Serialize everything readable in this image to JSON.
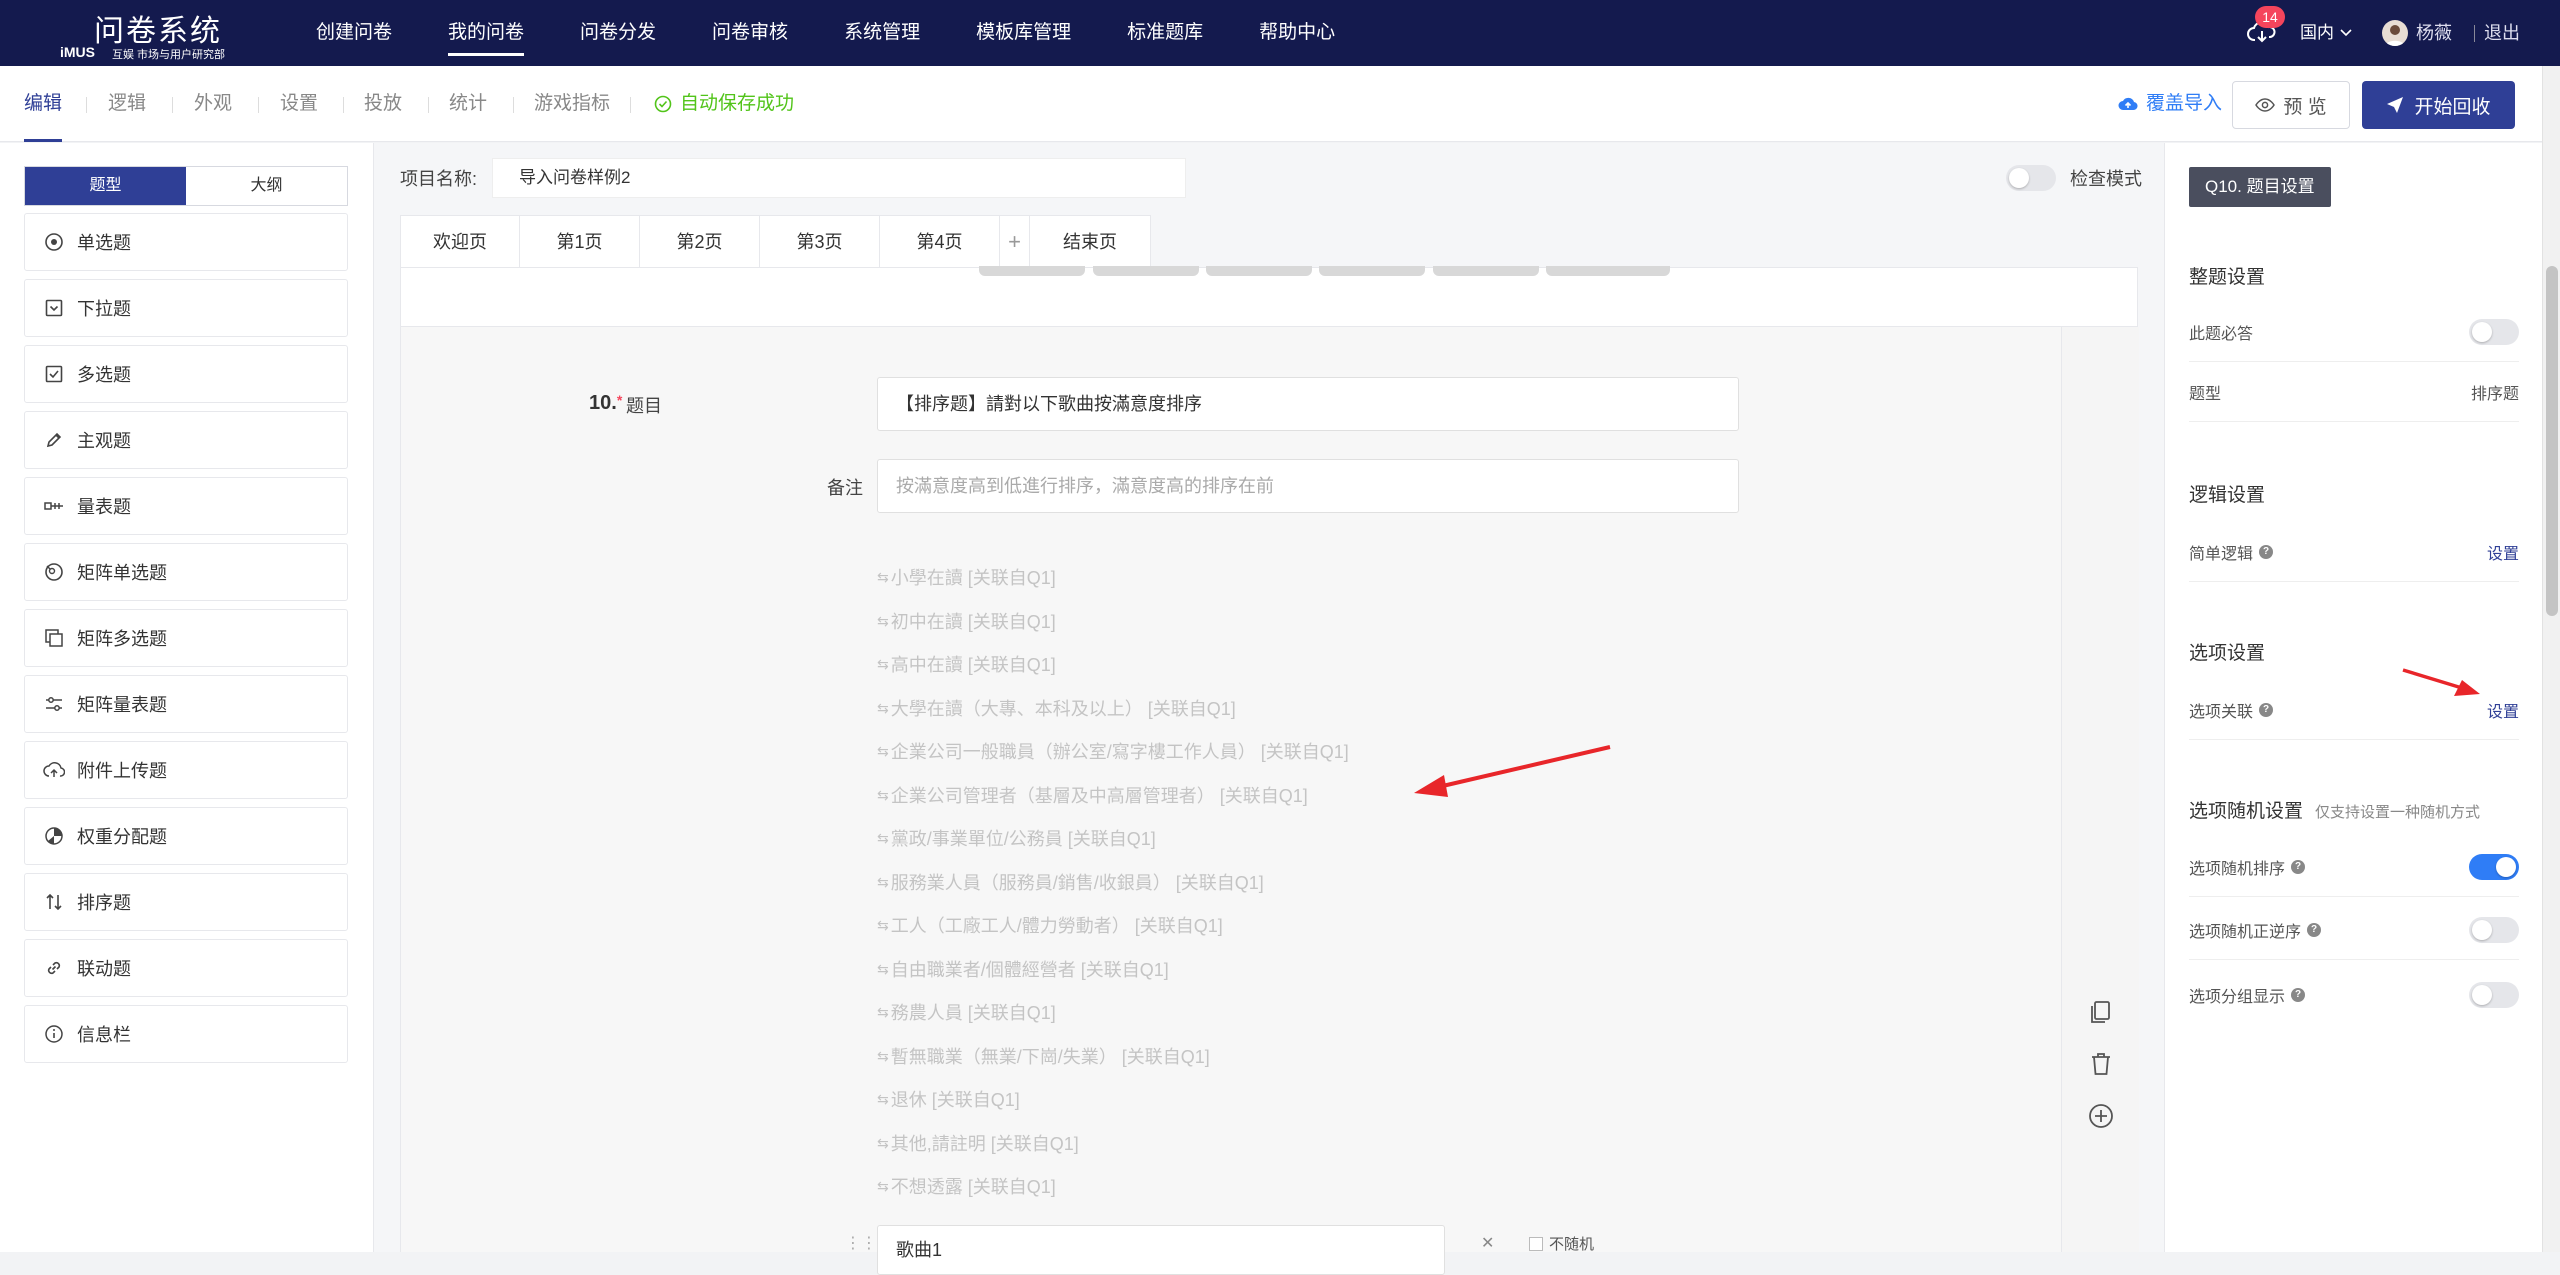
{
  "app": {
    "logo_title": "问卷系统",
    "logo_mark": "iMUS",
    "logo_sub": "互娱 市场与用户研究部"
  },
  "topnav": [
    {
      "label": "创建问卷",
      "active": false
    },
    {
      "label": "我的问卷",
      "active": true
    },
    {
      "label": "问卷分发",
      "active": false
    },
    {
      "label": "问卷审核",
      "active": false
    },
    {
      "label": "系统管理",
      "active": false
    },
    {
      "label": "模板库管理",
      "active": false
    },
    {
      "label": "标准题库",
      "active": false
    },
    {
      "label": "帮助中心",
      "active": false
    }
  ],
  "user": {
    "notification_count": "14",
    "region": "国内",
    "name": "杨薇",
    "logout": "退出"
  },
  "subnav": {
    "tabs": [
      "编辑",
      "逻辑",
      "外观",
      "设置",
      "投放",
      "统计",
      "游戏指标"
    ],
    "active_tab": "编辑",
    "autosave": "自动保存成功",
    "import": "覆盖导入",
    "preview": "预 览",
    "start": "开始回收"
  },
  "left_panel": {
    "tabs": [
      "题型",
      "大纲"
    ],
    "active_tab": "题型",
    "question_types": [
      {
        "label": "单选题",
        "icon": "radio-icon"
      },
      {
        "label": "下拉题",
        "icon": "dropdown-icon"
      },
      {
        "label": "多选题",
        "icon": "checkbox-icon"
      },
      {
        "label": "主观题",
        "icon": "pencil-icon"
      },
      {
        "label": "量表题",
        "icon": "scale-icon"
      },
      {
        "label": "矩阵单选题",
        "icon": "matrix-radio-icon"
      },
      {
        "label": "矩阵多选题",
        "icon": "matrix-checkbox-icon"
      },
      {
        "label": "矩阵量表题",
        "icon": "sliders-icon"
      },
      {
        "label": "附件上传题",
        "icon": "upload-icon"
      },
      {
        "label": "权重分配题",
        "icon": "pie-icon"
      },
      {
        "label": "排序题",
        "icon": "sort-icon"
      },
      {
        "label": "联动题",
        "icon": "link-icon"
      },
      {
        "label": "信息栏",
        "icon": "info-icon"
      }
    ]
  },
  "editor": {
    "project_label": "项目名称:",
    "project_name": "导入问卷样例2",
    "check_mode": "检查模式",
    "pages": [
      "欢迎页",
      "第1页",
      "第2页",
      "第3页",
      "第4页",
      "+",
      "结束页"
    ],
    "active_page": "第4页",
    "question": {
      "number": "10.",
      "required_mark": "*",
      "title_label": "题目",
      "title": "【排序题】請對以下歌曲按滿意度排序",
      "remark_label": "备注",
      "remark_placeholder": "按滿意度高到低進行排序，滿意度高的排序在前",
      "options": [
        "小學在讀 [关联自Q1]",
        "初中在讀 [关联自Q1]",
        "高中在讀 [关联自Q1]",
        "大學在讀（大專、本科及以上） [关联自Q1]",
        "企業公司一般職員（辦公室/寫字樓工作人員） [关联自Q1]",
        "企業公司管理者（基層及中高層管理者） [关联自Q1]",
        "黨政/事業單位/公務員 [关联自Q1]",
        "服務業人員（服務員/銷售/收銀員） [关联自Q1]",
        "工人（工廠工人/體力勞動者） [关联自Q1]",
        "自由職業者/個體經營者 [关联自Q1]",
        "務農人員 [关联自Q1]",
        "暫無職業（無業/下崗/失業） [关联自Q1]",
        "退休 [关联自Q1]",
        "其他,請註明 [关联自Q1]",
        "不想透露 [关联自Q1]"
      ],
      "song_value": "歌曲1",
      "no_random": "不随机"
    }
  },
  "right_panel": {
    "title": "Q10. 题目设置",
    "whole_settings": "整题设置",
    "required_label": "此题必答",
    "required_on": false,
    "type_label": "题型",
    "type_value": "排序题",
    "logic_settings": "逻辑设置",
    "simple_logic_label": "简单逻辑",
    "simple_logic_action": "设置",
    "option_settings": "选项设置",
    "option_link_label": "选项关联",
    "option_link_action": "设置",
    "random_settings": "选项随机设置",
    "random_note": "仅支持设置一种随机方式",
    "random_sort_label": "选项随机排序",
    "random_sort_on": true,
    "random_reverse_label": "选项随机正逆序",
    "random_reverse_on": false,
    "group_display_label": "选项分组显示",
    "group_display_on": false
  },
  "colors": {
    "header_bg": "#141a4e",
    "primary": "#2f3f96",
    "accent_blue": "#2f7df6",
    "success": "#52c41a",
    "badge": "#f5455c",
    "annotation_arrow": "#e8262a"
  }
}
